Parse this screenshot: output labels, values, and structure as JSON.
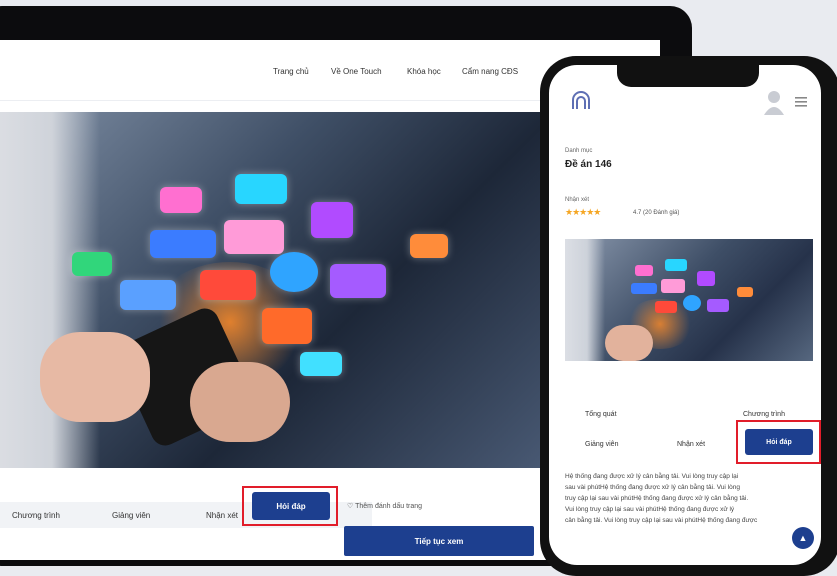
{
  "desktop": {
    "nav": [
      "Trang chủ",
      "Về One Touch",
      "Khóa học",
      "Cẩm nang CĐS"
    ],
    "tabs": [
      "Chương trình",
      "Giảng viên",
      "Nhận xét"
    ],
    "active_tab": "Hỏi đáp",
    "bookmark_label": "Thêm đánh dấu trang",
    "continue_label": "Tiếp tục xem"
  },
  "mobile": {
    "category_label": "Danh mục",
    "course_title": "Đề án 146",
    "reviews_label": "Nhận xét",
    "rating": 4.7,
    "rating_text": "4.7 (20 Đánh giá)",
    "tabs_row1": [
      "Tổng quát",
      "Chương trình"
    ],
    "tabs_row2": [
      "Giảng viên",
      "Nhận xét"
    ],
    "active_tab": "Hỏi đáp",
    "body_lines": [
      "Hệ thống đang được xử lý cân bằng tải. Vui lòng truy cập lại",
      "sau vài phútHệ thống đang được xử lý cân bằng tải. Vui lòng",
      "truy cập lại sau vài phútHệ thống đang được xử lý cân bằng tải.",
      "Vui lòng truy cập lại sau vài phútHệ thống đang được xử lý",
      "cân bằng tải. Vui lòng truy cập lại sau vài phútHệ thống đang được"
    ]
  },
  "icons": {
    "bookmark": "heart-outline-icon",
    "avatar": "user-silhouette-icon",
    "menu": "hamburger-icon",
    "logo": "arch-logo-icon",
    "scroll": "chevron-up-icon"
  },
  "colors": {
    "primary": "#1d3f8f",
    "highlight": "#e11d2a",
    "star": "#f5a623"
  }
}
